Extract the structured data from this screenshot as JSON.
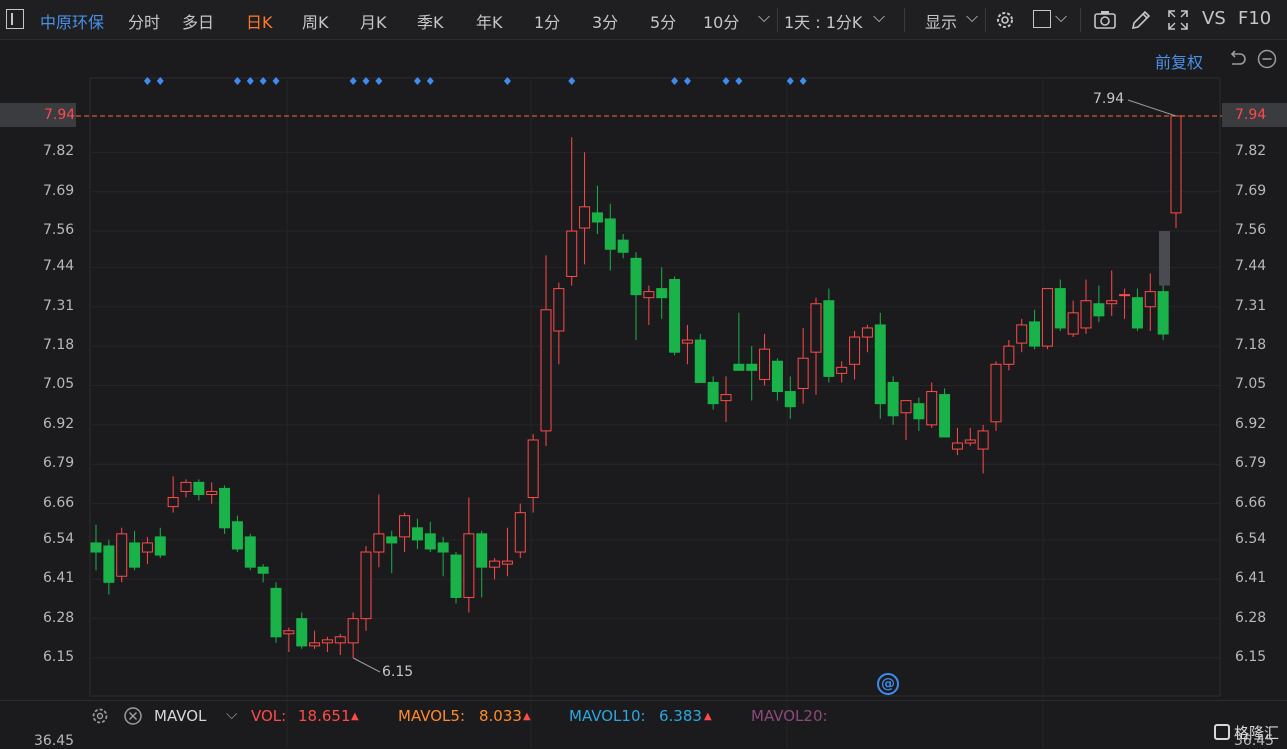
{
  "toolbar": {
    "stock_name": "中原环保",
    "tabs": [
      "分时",
      "多日",
      "日K",
      "周K",
      "月K",
      "季K",
      "年K",
      "1分",
      "3分",
      "5分",
      "10分"
    ],
    "active_tab": "日K",
    "period_select": "1天 : 1分K",
    "display_label": "显示",
    "vs_label": "VS",
    "f10_label": "F10"
  },
  "subbar": {
    "adjust_label": "前复权"
  },
  "price_axis": [
    "7.94",
    "7.82",
    "7.69",
    "7.56",
    "7.44",
    "7.31",
    "7.18",
    "7.05",
    "6.92",
    "6.79",
    "6.66",
    "6.54",
    "6.41",
    "6.28",
    "6.15"
  ],
  "current_price": "7.94",
  "high_annotation": "7.94",
  "low_annotation": "6.15",
  "chart_data": {
    "type": "candlestick",
    "ylim": [
      6.15,
      7.94
    ],
    "candles": [
      {
        "o": 6.53,
        "h": 6.59,
        "l": 6.44,
        "c": 6.5
      },
      {
        "o": 6.52,
        "h": 6.54,
        "l": 6.36,
        "c": 6.4
      },
      {
        "o": 6.42,
        "h": 6.58,
        "l": 6.4,
        "c": 6.56
      },
      {
        "o": 6.53,
        "h": 6.57,
        "l": 6.44,
        "c": 6.45
      },
      {
        "o": 6.5,
        "h": 6.55,
        "l": 6.46,
        "c": 6.53
      },
      {
        "o": 6.55,
        "h": 6.58,
        "l": 6.48,
        "c": 6.49
      },
      {
        "o": 6.65,
        "h": 6.75,
        "l": 6.63,
        "c": 6.68
      },
      {
        "o": 6.7,
        "h": 6.74,
        "l": 6.68,
        "c": 6.73
      },
      {
        "o": 6.73,
        "h": 6.74,
        "l": 6.67,
        "c": 6.69
      },
      {
        "o": 6.69,
        "h": 6.73,
        "l": 6.66,
        "c": 6.7
      },
      {
        "o": 6.71,
        "h": 6.72,
        "l": 6.56,
        "c": 6.58
      },
      {
        "o": 6.6,
        "h": 6.62,
        "l": 6.5,
        "c": 6.51
      },
      {
        "o": 6.55,
        "h": 6.56,
        "l": 6.44,
        "c": 6.45
      },
      {
        "o": 6.45,
        "h": 6.46,
        "l": 6.4,
        "c": 6.43
      },
      {
        "o": 6.38,
        "h": 6.4,
        "l": 6.2,
        "c": 6.22
      },
      {
        "o": 6.23,
        "h": 6.25,
        "l": 6.17,
        "c": 6.24
      },
      {
        "o": 6.28,
        "h": 6.3,
        "l": 6.18,
        "c": 6.19
      },
      {
        "o": 6.19,
        "h": 6.24,
        "l": 6.18,
        "c": 6.2
      },
      {
        "o": 6.2,
        "h": 6.22,
        "l": 6.17,
        "c": 6.21
      },
      {
        "o": 6.2,
        "h": 6.23,
        "l": 6.16,
        "c": 6.22
      },
      {
        "o": 6.2,
        "h": 6.3,
        "l": 6.15,
        "c": 6.28
      },
      {
        "o": 6.28,
        "h": 6.52,
        "l": 6.24,
        "c": 6.5
      },
      {
        "o": 6.5,
        "h": 6.69,
        "l": 6.45,
        "c": 6.56
      },
      {
        "o": 6.55,
        "h": 6.57,
        "l": 6.43,
        "c": 6.53
      },
      {
        "o": 6.55,
        "h": 6.63,
        "l": 6.5,
        "c": 6.62
      },
      {
        "o": 6.58,
        "h": 6.61,
        "l": 6.51,
        "c": 6.54
      },
      {
        "o": 6.56,
        "h": 6.6,
        "l": 6.5,
        "c": 6.51
      },
      {
        "o": 6.53,
        "h": 6.55,
        "l": 6.42,
        "c": 6.5
      },
      {
        "o": 6.49,
        "h": 6.5,
        "l": 6.33,
        "c": 6.35
      },
      {
        "o": 6.35,
        "h": 6.68,
        "l": 6.3,
        "c": 6.56
      },
      {
        "o": 6.56,
        "h": 6.57,
        "l": 6.35,
        "c": 6.45
      },
      {
        "o": 6.45,
        "h": 6.48,
        "l": 6.41,
        "c": 6.47
      },
      {
        "o": 6.46,
        "h": 6.58,
        "l": 6.42,
        "c": 6.47
      },
      {
        "o": 6.5,
        "h": 6.66,
        "l": 6.48,
        "c": 6.63
      },
      {
        "o": 6.68,
        "h": 6.89,
        "l": 6.63,
        "c": 6.87
      },
      {
        "o": 6.9,
        "h": 7.48,
        "l": 6.85,
        "c": 7.3
      },
      {
        "o": 7.23,
        "h": 7.39,
        "l": 7.12,
        "c": 7.37
      },
      {
        "o": 7.41,
        "h": 7.87,
        "l": 7.38,
        "c": 7.56
      },
      {
        "o": 7.57,
        "h": 7.82,
        "l": 7.45,
        "c": 7.64
      },
      {
        "o": 7.62,
        "h": 7.71,
        "l": 7.55,
        "c": 7.59
      },
      {
        "o": 7.6,
        "h": 7.65,
        "l": 7.43,
        "c": 7.5
      },
      {
        "o": 7.53,
        "h": 7.55,
        "l": 7.47,
        "c": 7.49
      },
      {
        "o": 7.47,
        "h": 7.49,
        "l": 7.2,
        "c": 7.35
      },
      {
        "o": 7.34,
        "h": 7.38,
        "l": 7.25,
        "c": 7.36
      },
      {
        "o": 7.37,
        "h": 7.44,
        "l": 7.27,
        "c": 7.34
      },
      {
        "o": 7.4,
        "h": 7.41,
        "l": 7.15,
        "c": 7.16
      },
      {
        "o": 7.19,
        "h": 7.25,
        "l": 7.12,
        "c": 7.2
      },
      {
        "o": 7.2,
        "h": 7.22,
        "l": 7.06,
        "c": 7.06
      },
      {
        "o": 7.06,
        "h": 7.08,
        "l": 6.97,
        "c": 6.99
      },
      {
        "o": 7.0,
        "h": 7.08,
        "l": 6.93,
        "c": 7.02
      },
      {
        "o": 7.12,
        "h": 7.29,
        "l": 7.11,
        "c": 7.1
      },
      {
        "o": 7.12,
        "h": 7.18,
        "l": 7.0,
        "c": 7.1
      },
      {
        "o": 7.07,
        "h": 7.22,
        "l": 7.05,
        "c": 7.17
      },
      {
        "o": 7.13,
        "h": 7.14,
        "l": 7.0,
        "c": 7.03
      },
      {
        "o": 7.03,
        "h": 7.08,
        "l": 6.94,
        "c": 6.98
      },
      {
        "o": 7.04,
        "h": 7.24,
        "l": 6.99,
        "c": 7.14
      },
      {
        "o": 7.16,
        "h": 7.34,
        "l": 7.02,
        "c": 7.32
      },
      {
        "o": 7.33,
        "h": 7.37,
        "l": 7.06,
        "c": 7.08
      },
      {
        "o": 7.09,
        "h": 7.13,
        "l": 7.06,
        "c": 7.11
      },
      {
        "o": 7.12,
        "h": 7.23,
        "l": 7.07,
        "c": 7.21
      },
      {
        "o": 7.21,
        "h": 7.25,
        "l": 7.16,
        "c": 7.24
      },
      {
        "o": 7.25,
        "h": 7.29,
        "l": 6.94,
        "c": 6.99
      },
      {
        "o": 7.06,
        "h": 7.08,
        "l": 6.92,
        "c": 6.95
      },
      {
        "o": 6.96,
        "h": 7.0,
        "l": 6.87,
        "c": 7.0
      },
      {
        "o": 6.99,
        "h": 7.01,
        "l": 6.9,
        "c": 6.94
      },
      {
        "o": 6.92,
        "h": 7.06,
        "l": 6.91,
        "c": 7.03
      },
      {
        "o": 7.02,
        "h": 7.04,
        "l": 6.88,
        "c": 6.88
      },
      {
        "o": 6.84,
        "h": 6.91,
        "l": 6.82,
        "c": 6.86
      },
      {
        "o": 6.86,
        "h": 6.91,
        "l": 6.85,
        "c": 6.87
      },
      {
        "o": 6.84,
        "h": 6.92,
        "l": 6.76,
        "c": 6.9
      },
      {
        "o": 6.93,
        "h": 7.13,
        "l": 6.9,
        "c": 7.12
      },
      {
        "o": 7.12,
        "h": 7.2,
        "l": 7.1,
        "c": 7.18
      },
      {
        "o": 7.19,
        "h": 7.27,
        "l": 7.16,
        "c": 7.25
      },
      {
        "o": 7.26,
        "h": 7.3,
        "l": 7.17,
        "c": 7.18
      },
      {
        "o": 7.18,
        "h": 7.36,
        "l": 7.17,
        "c": 7.37
      },
      {
        "o": 7.37,
        "h": 7.4,
        "l": 7.23,
        "c": 7.24
      },
      {
        "o": 7.22,
        "h": 7.33,
        "l": 7.21,
        "c": 7.29
      },
      {
        "o": 7.24,
        "h": 7.4,
        "l": 7.22,
        "c": 7.33
      },
      {
        "o": 7.32,
        "h": 7.38,
        "l": 7.26,
        "c": 7.28
      },
      {
        "o": 7.32,
        "h": 7.43,
        "l": 7.28,
        "c": 7.33
      },
      {
        "o": 7.35,
        "h": 7.37,
        "l": 7.27,
        "c": 7.35
      },
      {
        "o": 7.34,
        "h": 7.37,
        "l": 7.23,
        "c": 7.24
      },
      {
        "o": 7.31,
        "h": 7.42,
        "l": 7.23,
        "c": 7.36
      },
      {
        "o": 7.36,
        "h": 7.4,
        "l": 7.2,
        "c": 7.22
      },
      {
        "o": 7.62,
        "h": 7.94,
        "l": 7.57,
        "c": 7.94
      }
    ],
    "marker_days": [
      4,
      5,
      11,
      12,
      13,
      14,
      20,
      21,
      22,
      25,
      26,
      32,
      37,
      45,
      46,
      49,
      50,
      54,
      55
    ],
    "grid": true
  },
  "volbar": {
    "indicator": "MAVOL",
    "vol_label": "VOL:",
    "vol_value": "18.651",
    "mavol5_label": "MAVOL5:",
    "mavol5_value": "8.033",
    "mavol10_label": "MAVOL10:",
    "mavol10_value": "6.383",
    "mavol20_label": "MAVOL20:",
    "axis_value": "36.45"
  },
  "watermark": "格隆汇",
  "colors": {
    "up": "#ff4a4a",
    "down": "#19b34a",
    "stock": "#4a8fe8",
    "active": "#ff7a2a",
    "marker": "#3f8bf0"
  }
}
